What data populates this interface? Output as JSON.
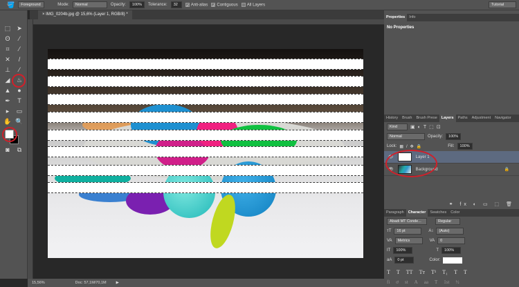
{
  "options_bar": {
    "tool_icon": "paint-bucket-icon",
    "fill_source": "Foreground",
    "mode_label": "Mode:",
    "mode": "Normal",
    "opacity_label": "Opacity:",
    "opacity": "100%",
    "tolerance_label": "Tolerance:",
    "tolerance": "32",
    "anti_alias": "Anti-alias",
    "anti_alias_checked": true,
    "contiguous": "Contiguous",
    "contiguous_checked": true,
    "all_layers": "All Layers",
    "all_layers_checked": false,
    "workspace": "Tutorial"
  },
  "document": {
    "tab_title": "IMG_0204b.jpg @ 15,6% (Layer 1, RGB/8) *"
  },
  "status": {
    "zoom": "15,56%",
    "doc": "Doc: 57,1M/70,1M"
  },
  "properties": {
    "tabs": [
      "Properties",
      "Info"
    ],
    "content": "No Properties"
  },
  "layers_panel": {
    "tabs": [
      "History",
      "Brush",
      "Brush Prese",
      "Layers",
      "Paths",
      "Adjustment",
      "Navigator"
    ],
    "active_tab": "Layers",
    "filter": "Kind",
    "blend_mode": "Normal",
    "opacity_label": "Opacity:",
    "opacity": "100%",
    "lock_label": "Lock:",
    "fill_label": "Fill:",
    "fill": "100%",
    "layers": [
      {
        "name": "Layer 1",
        "selected": true
      },
      {
        "name": "Background",
        "locked": true
      }
    ]
  },
  "character": {
    "tabs": [
      "Paragraph",
      "Character",
      "Swatches",
      "Color"
    ],
    "active_tab": "Character",
    "font": "Abadi MT Conde...",
    "style": "Regular",
    "size": "16 pt",
    "leading": "(Auto)",
    "kerning": "Metrics",
    "tracking": "0",
    "vscale": "100%",
    "hscale": "100%",
    "baseline": "0 pt",
    "color_label": "Color:",
    "color": "#ffffff",
    "style_buttons": [
      "T",
      "T",
      "TT",
      "Tт",
      "T¹",
      "T₁",
      "T",
      "T"
    ],
    "ot_buttons": [
      "fi",
      "ơ",
      "st",
      "A",
      "aa",
      "T",
      "1st",
      "½"
    ]
  },
  "annotation_color": "#d0202a"
}
